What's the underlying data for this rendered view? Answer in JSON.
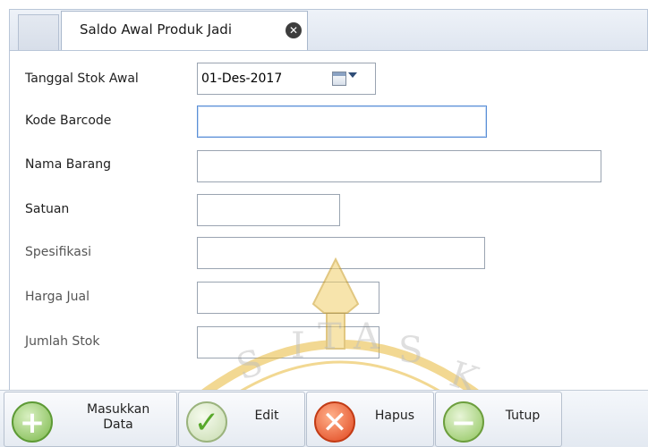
{
  "tab": {
    "title": "Saldo Awal Produk Jadi",
    "close_glyph": "✕"
  },
  "form": {
    "tanggal_label": "Tanggal Stok Awal",
    "tanggal_value": "01-Des-2017",
    "kode_label": "Kode Barcode",
    "kode_value": "",
    "nama_label": "Nama Barang",
    "nama_value": "",
    "satuan_label": "Satuan",
    "satuan_value": "",
    "spesifikasi_label": "Spesifikasi",
    "spesifikasi_value": "",
    "harga_label": "Harga Jual",
    "harga_value": "",
    "jumlah_label": "Jumlah Stok",
    "jumlah_value": ""
  },
  "toolbar": {
    "add_line1": "Masukkan",
    "add_line2": "Data",
    "edit_label": "Edit",
    "hapus_label": "Hapus",
    "tutup_label": "Tutup"
  },
  "icons": {
    "add": "plus-circle-icon",
    "edit": "checkmark-circle-icon",
    "hapus": "x-circle-icon",
    "tutup": "minus-circle-icon",
    "date": "calendar-icon"
  },
  "colors": {
    "accent_focus": "#5b8fd6",
    "watermark": "#e8b93a"
  }
}
